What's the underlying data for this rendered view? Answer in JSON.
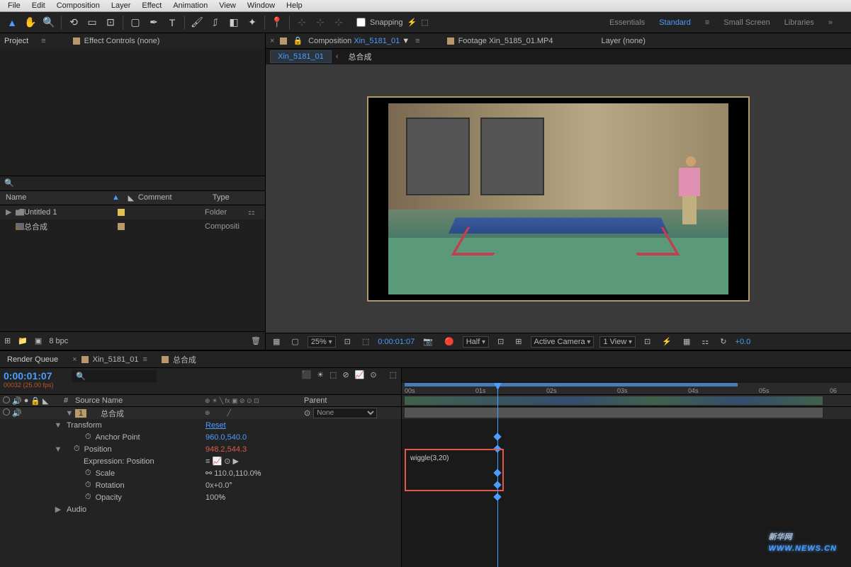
{
  "menu": {
    "file": "File",
    "edit": "Edit",
    "composition": "Composition",
    "layer": "Layer",
    "effect": "Effect",
    "animation": "Animation",
    "view": "View",
    "window": "Window",
    "help": "Help"
  },
  "toolbar": {
    "snapping": "Snapping"
  },
  "workspaces": {
    "essentials": "Essentials",
    "standard": "Standard",
    "small": "Small Screen",
    "libraries": "Libraries"
  },
  "project": {
    "tab": "Project",
    "fx_tab": "Effect Controls (none)",
    "headers": {
      "name": "Name",
      "label": "●",
      "comment": "Comment",
      "type": "Type"
    },
    "items": [
      {
        "name": "Untitled 1",
        "type": "Folder",
        "color": "#e0c050"
      },
      {
        "name": "总合成",
        "type": "Compositi",
        "color": "#b89a6a"
      }
    ],
    "bpc": "8 bpc"
  },
  "comp_tabs": {
    "active": "Composition",
    "active_name": "Xin_5181_01",
    "footage": "Footage Xin_5185_01.MP4",
    "layer": "Layer (none)"
  },
  "breadcrumb": {
    "c1": "Xin_5181_01",
    "c2": "总合成"
  },
  "viewer": {
    "zoom": "25%",
    "timecode": "0:00:01:07",
    "res": "Half",
    "camera": "Active Camera",
    "view": "1 View",
    "exposure": "+0.0"
  },
  "timeline": {
    "tabs": {
      "render": "Render Queue",
      "t1": "Xin_5181_01",
      "t2": "总合成"
    },
    "timecode": "0:00:01:07",
    "fps": "00032 (25.00 fps)",
    "cols": {
      "num": "#",
      "source": "Source Name",
      "parent": "Parent"
    },
    "layer": {
      "num": "1",
      "name": "总合成",
      "parent": "None"
    },
    "props": {
      "transform": "Transform",
      "reset": "Reset",
      "anchor": "Anchor Point",
      "anchor_v": "960.0,540.0",
      "position": "Position",
      "position_v": "948.2,544.3",
      "expr": "Expression: Position",
      "scale": "Scale",
      "scale_v": "110.0,110.0",
      "scale_u": "%",
      "rotation": "Rotation",
      "rotation_v": "0x",
      "rotation_d": "+0.0",
      "rotation_u": "°",
      "opacity": "Opacity",
      "opacity_v": "100",
      "opacity_u": "%",
      "audio": "Audio"
    },
    "expression": "wiggle(3,20)",
    "ruler": [
      "00s",
      "01s",
      "02s",
      "03s",
      "04s",
      "05s",
      "06"
    ]
  },
  "watermark": {
    "main": "新华网",
    "sub": "WWW.NEWS.CN"
  }
}
